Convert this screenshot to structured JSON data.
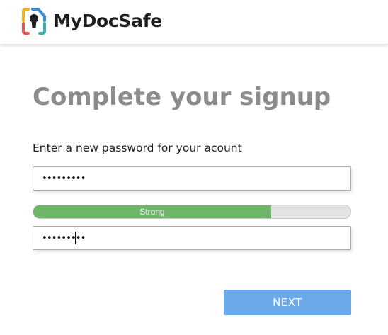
{
  "header": {
    "brand_name": "MyDocSafe",
    "logo_icon": "keyhole-shield-icon"
  },
  "main": {
    "title": "Complete your signup",
    "instruction": "Enter a new password for your acount",
    "password_field": {
      "value": "•••••••••",
      "type": "password"
    },
    "strength_meter": {
      "label": "Strong",
      "level": 0.75,
      "fill_color": "#6db567"
    },
    "confirm_field": {
      "value": "•••••••••",
      "type": "password"
    },
    "next_button": {
      "label": "NEXT",
      "color": "#6aaaea"
    }
  }
}
